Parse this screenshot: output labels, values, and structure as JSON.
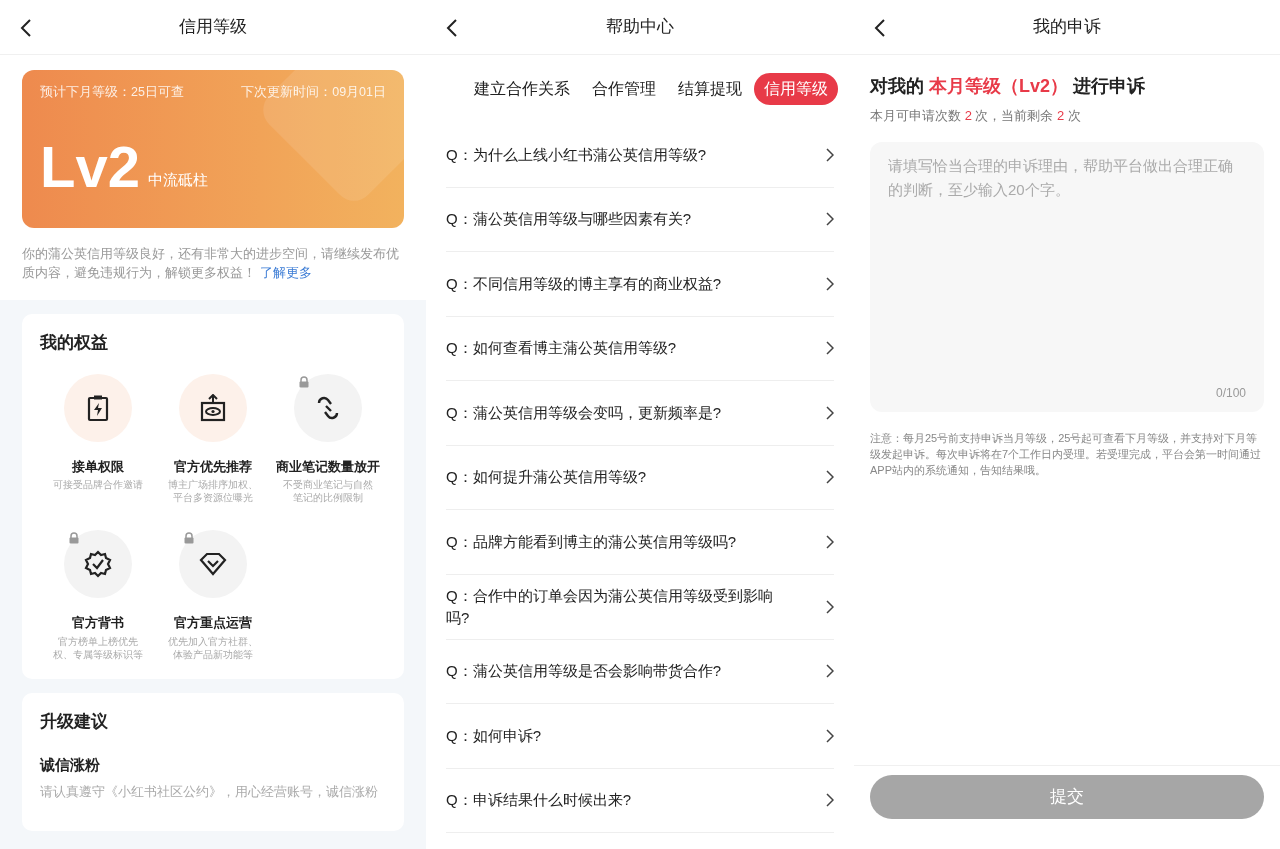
{
  "credit_page": {
    "title": "信用等级",
    "card": {
      "next_month": "预计下月等级：25日可查",
      "next_update": "下次更新时间：09月01日",
      "level": "Lv2",
      "level_name": "中流砥柱"
    },
    "description": "你的蒲公英信用等级良好，还有非常大的进步空间，请继续发布优质内容，避免违规行为，解锁更多权益！",
    "learn_more": "了解更多",
    "benefits_title": "我的权益",
    "benefits": [
      {
        "name": "接单权限",
        "desc": "可接受品牌合作邀请",
        "locked": false
      },
      {
        "name": "官方优先推荐",
        "desc": "博主广场排序加权、平台多资源位曝光",
        "locked": false
      },
      {
        "name": "商业笔记数量放开",
        "desc": "不受商业笔记与自然笔记的比例限制",
        "locked": true
      },
      {
        "name": "官方背书",
        "desc": "官方榜单上榜优先权、专属等级标识等",
        "locked": true
      },
      {
        "name": "官方重点运营",
        "desc": "优先加入官方社群、体验产品新功能等",
        "locked": true
      }
    ],
    "advice_title": "升级建议",
    "advice": [
      {
        "title": "诚信涨粉",
        "desc": "请认真遵守《小红书社区公约》，用心经营账号，诚信涨粉"
      }
    ]
  },
  "help_page": {
    "title": "帮助中心",
    "tabs": [
      {
        "label": "建立合作关系",
        "selected": false
      },
      {
        "label": "合作管理",
        "selected": false
      },
      {
        "label": "结算提现",
        "selected": false
      },
      {
        "label": "信用等级",
        "selected": true
      }
    ],
    "questions": [
      "Q：为什么上线小红书蒲公英信用等级?",
      "Q：蒲公英信用等级与哪些因素有关?",
      "Q：不同信用等级的博主享有的商业权益?",
      "Q：如何查看博主蒲公英信用等级?",
      "Q：蒲公英信用等级会变吗，更新频率是?",
      "Q：如何提升蒲公英信用等级?",
      "Q：品牌方能看到博主的蒲公英信用等级吗?",
      "Q：合作中的订单会因为蒲公英信用等级受到影响吗?",
      "Q：蒲公英信用等级是否会影响带货合作?",
      "Q：如何申诉?",
      "Q：申诉结果什么时候出来?"
    ]
  },
  "appeal_page": {
    "title": "我的申诉",
    "heading": [
      {
        "text": "对我的 ",
        "highlight": false
      },
      {
        "text": "本月等级（Lv2）",
        "highlight": true
      },
      {
        "text": " 进行申诉",
        "highlight": false
      }
    ],
    "quota": [
      {
        "text": "本月可申请次数 ",
        "highlight": false
      },
      {
        "text": "2",
        "highlight": true
      },
      {
        "text": " 次，当前剩余 ",
        "highlight": false
      },
      {
        "text": "2",
        "highlight": true
      },
      {
        "text": " 次",
        "highlight": false
      }
    ],
    "reason_placeholder": "请填写恰当合理的申诉理由，帮助平台做出合理正确的判断，至少输入20个字。",
    "counter": "0/100",
    "note": "注意：每月25号前支持申诉当月等级，25号起可查看下月等级，并支持对下月等级发起申诉。每次申诉将在7个工作日内受理。若受理完成，平台会第一时间通过APP站内的系统通知，告知结果哦。",
    "submit": {
      "label": "提交",
      "disabled": true
    }
  }
}
